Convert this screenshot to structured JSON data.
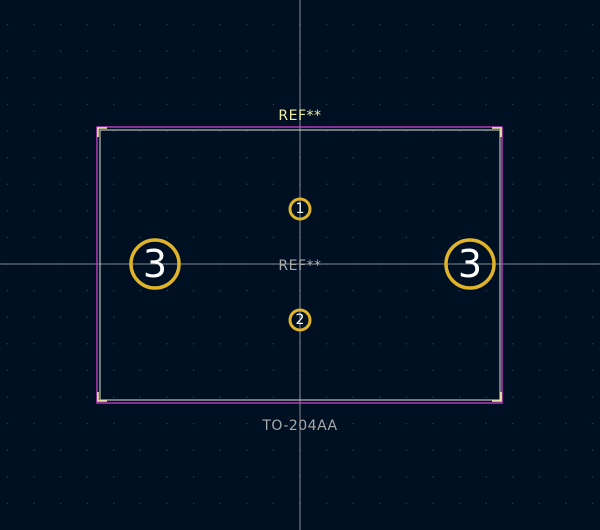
{
  "footprint": {
    "reference_silk": "REF**",
    "reference_fab": "REF**",
    "value": "TO-204AA"
  },
  "pads": [
    {
      "number": "1"
    },
    {
      "number": "2"
    },
    {
      "number": "3"
    },
    {
      "number": "3"
    }
  ],
  "colors": {
    "background": "#001023",
    "grid": "#26374f",
    "crosshair": "#c8c8c8",
    "courtyard": "#d040d0",
    "fab_outline": "#bdbdbd",
    "silkscreen": "#f2eda1",
    "pad_ring": "#e0b428",
    "pad_text": "#ffffff",
    "fab_text": "#a9a9a9"
  }
}
